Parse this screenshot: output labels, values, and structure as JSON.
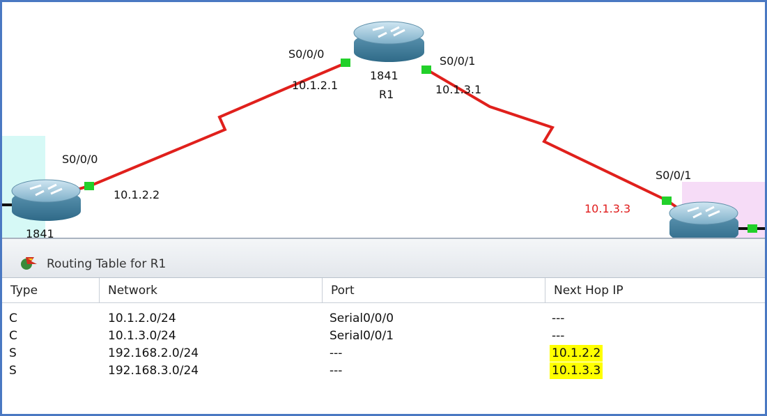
{
  "topology": {
    "routers": [
      {
        "id": "r1",
        "model": "1841",
        "name": "R1"
      },
      {
        "id": "r-left",
        "model": "1841"
      },
      {
        "id": "r-right"
      }
    ],
    "labels": {
      "r1_s000_port": "S0/0/0",
      "r1_s001_port": "S0/0/1",
      "r1_s000_ip": "10.1.2.1",
      "r1_s001_ip": "10.1.3.1",
      "left_s000_port": "S0/0/0",
      "left_ip": "10.1.2.2",
      "right_s001_port": "S0/0/1",
      "right_ip": "10.1.3.3"
    },
    "colors": {
      "link": "#e0201c",
      "port": "#22d02a",
      "right_ip_text": "#e01b1b",
      "cyan_area": "#d6f9f6",
      "pink_area": "#f6dcf7"
    }
  },
  "panel": {
    "title": "Routing Table for R1",
    "icon": "routing-table-icon",
    "columns": [
      "Type",
      "Network",
      "Port",
      "Next Hop IP"
    ],
    "rows": [
      {
        "type": "C",
        "network": "10.1.2.0/24",
        "port": "Serial0/0/0",
        "next_hop": "---",
        "highlight": false
      },
      {
        "type": "C",
        "network": "10.1.3.0/24",
        "port": "Serial0/0/1",
        "next_hop": "---",
        "highlight": false
      },
      {
        "type": "S",
        "network": "192.168.2.0/24",
        "port": "---",
        "next_hop": "10.1.2.2",
        "highlight": true
      },
      {
        "type": "S",
        "network": "192.168.3.0/24",
        "port": "---",
        "next_hop": "10.1.3.3",
        "highlight": true
      }
    ],
    "highlight_color": "#ffff00"
  }
}
